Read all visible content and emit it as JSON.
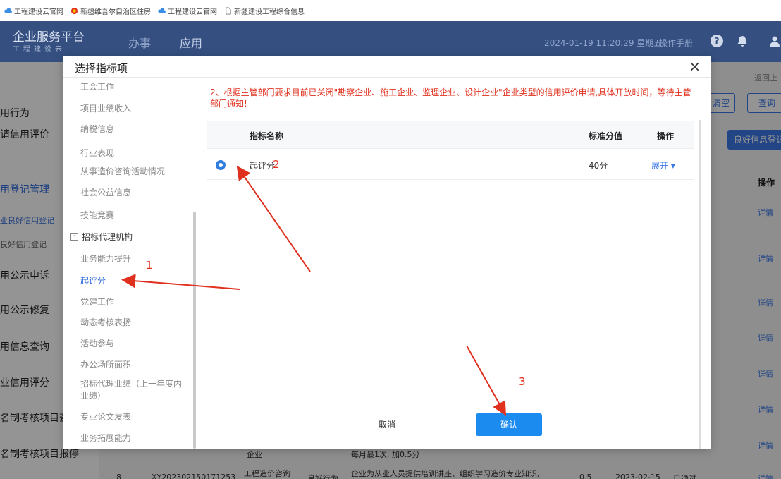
{
  "bookmarks": [
    {
      "label": "工程建设云官网",
      "icon": "cloud-icon"
    },
    {
      "label": "新疆维吾尔自治区住房",
      "icon": "emblem-icon"
    },
    {
      "label": "工程建设云官网",
      "icon": "cloud-icon"
    },
    {
      "label": "新疆建设工程综合信息",
      "icon": "page-icon"
    }
  ],
  "header": {
    "logo_title": "企业服务平台",
    "logo_subtitle": "工程建设云",
    "nav": [
      "办事",
      "应用"
    ],
    "datetime": "2024-01-19 11:20:29 星期五",
    "manual": "操作手册",
    "help": "?"
  },
  "background": {
    "sidebar": [
      "用行为",
      "请信用评价",
      "用登记管理",
      "业良好信用登记",
      "良好信用登记",
      "用公示申诉",
      "用公示修复",
      "用信息查询",
      "业信用评分",
      "名制考核项目查",
      "名制考核项目报停"
    ],
    "back_link": "返回上",
    "buttons": {
      "clear": "清空",
      "query": "查询",
      "good_info_register": "良好信息登记"
    },
    "column_op": "操作",
    "detail": "详情",
    "row_partial": {
      "index": "8",
      "code": "XY202302150171253",
      "type": "工程造价咨询",
      "behavior": "良好行为",
      "desc": "企业为从业人员提供培训讲座、组织学习造价专业知识,",
      "score": "0.5",
      "date": "2023-02-15",
      "status": "已通过",
      "prev_frag_1": "企业",
      "prev_frag_2": "每月最1次, 加0.5分"
    }
  },
  "modal": {
    "title": "选择指标项",
    "close": "×",
    "tree_items_before": [
      "工会工作",
      "项目业绩收入",
      "纳税信息",
      "行业表现",
      "从事造价咨询活动情况",
      "社会公益信息",
      "技能竞赛"
    ],
    "tree_category": "招标代理机构",
    "tree_children": [
      "业务能力提升",
      "起评分",
      "党建工作",
      "动态考核表扬",
      "活动参与",
      "办公场所面积",
      "招标代理业绩（上一年度内业绩）",
      "专业论文发表",
      "业务拓展能力"
    ],
    "selected_child": "起评分",
    "notice": "2、根据主管部门要求目前已关闭\"勘察企业、施工企业、监理企业、设计企业\"企业类型的信用评价申请,具体开放时间，等待主管部门通知!",
    "table": {
      "headers": {
        "name": "指标名称",
        "score": "标准分值",
        "op": "操作"
      },
      "rows": [
        {
          "name": "起评分",
          "score": "40分",
          "op": "展开 ▾"
        }
      ]
    },
    "cancel": "取消",
    "confirm": "确认"
  },
  "annotations": {
    "one": "1",
    "two": "2",
    "three": "3",
    "color": "#e0301e"
  }
}
